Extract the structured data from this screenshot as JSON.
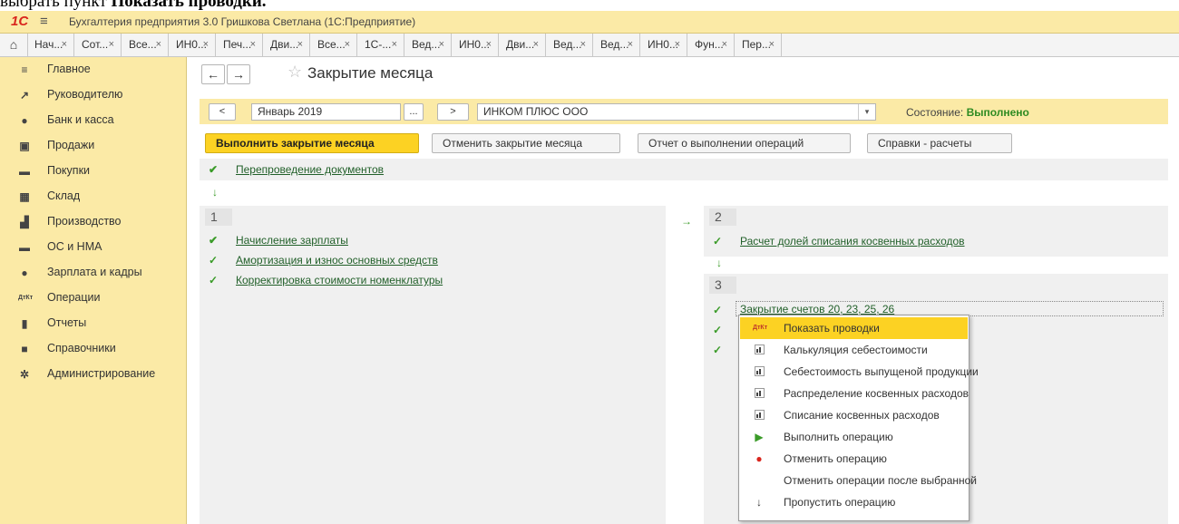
{
  "doc_text": {
    "prefix": "выбрать пункт ",
    "bold": "Показать проводки."
  },
  "titlebar": {
    "logo": "1С",
    "title": "Бухгалтерия предприятия 3.0 Гришкова Светлана  (1С:Предприятие)"
  },
  "tabs": [
    "Нач...",
    "Сот...",
    "Все...",
    "ИН0...",
    "Печ...",
    "Дви...",
    "Все...",
    "1С-...",
    "Вед...",
    "ИН0...",
    "Дви...",
    "Вед...",
    "Вед...",
    "ИН0...",
    "Фун...",
    "Пер..."
  ],
  "tab_close": "×",
  "sidebar": {
    "items": [
      {
        "label": "Главное",
        "icon": "menu-icon"
      },
      {
        "label": "Руководителю",
        "icon": "trend-icon"
      },
      {
        "label": "Банк и касса",
        "icon": "bank-icon"
      },
      {
        "label": "Продажи",
        "icon": "cart-bag-icon"
      },
      {
        "label": "Покупки",
        "icon": "cart-icon"
      },
      {
        "label": "Склад",
        "icon": "warehouse-icon"
      },
      {
        "label": "Производство",
        "icon": "factory-icon"
      },
      {
        "label": "ОС и НМА",
        "icon": "truck-icon"
      },
      {
        "label": "Зарплата и кадры",
        "icon": "person-icon"
      },
      {
        "label": "Операции",
        "icon": "dt-kt-icon"
      },
      {
        "label": "Отчеты",
        "icon": "bar-chart-icon"
      },
      {
        "label": "Справочники",
        "icon": "book-icon"
      },
      {
        "label": "Администрирование",
        "icon": "gear-icon"
      }
    ]
  },
  "page": {
    "title": "Закрытие месяца"
  },
  "period": {
    "prev": "<",
    "month": "Январь 2019",
    "ellipsis": "...",
    "next": ">",
    "org": "ИНКОМ ПЛЮС ООО",
    "state_label": "Состояние:",
    "state_value": "Выполнено"
  },
  "actions": {
    "close_month": "Выполнить закрытие месяца",
    "cancel_close": "Отменить закрытие месяца",
    "report": "Отчет о выполнении операций",
    "help": "Справки - расчеты"
  },
  "steps": {
    "repost": "Перепроведение документов",
    "block1_num": "1",
    "block1": [
      "Начисление зарплаты",
      "Амортизация и износ основных средств",
      "Корректировка стоимости номенклатуры"
    ],
    "block2_num": "2",
    "block2": [
      "Расчет долей списания косвенных расходов"
    ],
    "block3_num": "3",
    "block3": [
      "Закрытие счетов 20, 23, 25, 26"
    ]
  },
  "context_menu": [
    {
      "label": "Показать проводки",
      "icon": "dt-kt-icon"
    },
    {
      "label": "Калькуляция себестоимости",
      "icon": "report-icon"
    },
    {
      "label": "Себестоимость выпущеной продукции",
      "icon": "report-icon"
    },
    {
      "label": "Распределение косвенных расходов",
      "icon": "report-icon"
    },
    {
      "label": "Списание косвенных расходов",
      "icon": "report-icon"
    },
    {
      "label": "Выполнить операцию",
      "icon": "execute-icon"
    },
    {
      "label": "Отменить операцию",
      "icon": "cancel-op-icon"
    },
    {
      "label": "Отменить операции после выбранной",
      "icon": ""
    },
    {
      "label": "Пропустить операцию",
      "icon": "arrow-down-icon"
    }
  ],
  "colors": {
    "accent_yellow": "#fcd223",
    "panel_yellow": "#fbeaa6",
    "success_green": "#3a9b28",
    "brand_red": "#d9251d"
  }
}
